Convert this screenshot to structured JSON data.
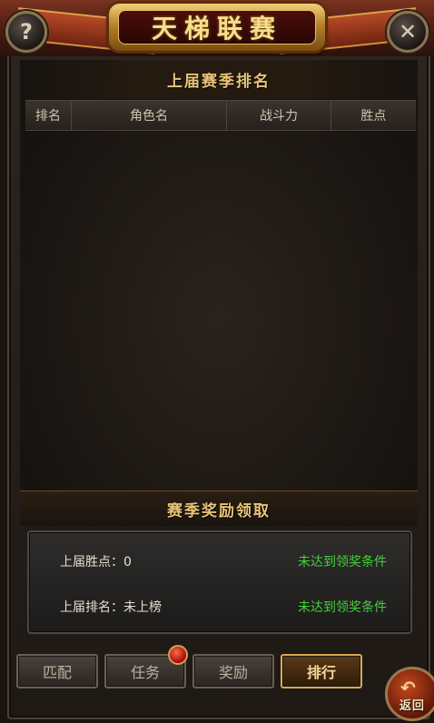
{
  "header": {
    "title": "天梯联赛",
    "help_icon": "?",
    "close_icon": "✕"
  },
  "ranking": {
    "title": "上届赛季排名",
    "columns": [
      "排名",
      "角色名",
      "战斗力",
      "胜点"
    ]
  },
  "rewards": {
    "title": "赛季奖励领取",
    "rows": [
      {
        "label": "上届胜点：0",
        "status": "未达到领奖条件"
      },
      {
        "label": "上届排名：未上榜",
        "status": "未达到领奖条件"
      }
    ],
    "status_color": "#44d23c"
  },
  "tabs": [
    {
      "label": "匹配",
      "active": false
    },
    {
      "label": "任务",
      "active": false,
      "badge": true
    },
    {
      "label": "奖励",
      "active": false
    },
    {
      "label": "排行",
      "active": true
    }
  ],
  "back_button": {
    "label": "返回",
    "icon": "↶"
  }
}
